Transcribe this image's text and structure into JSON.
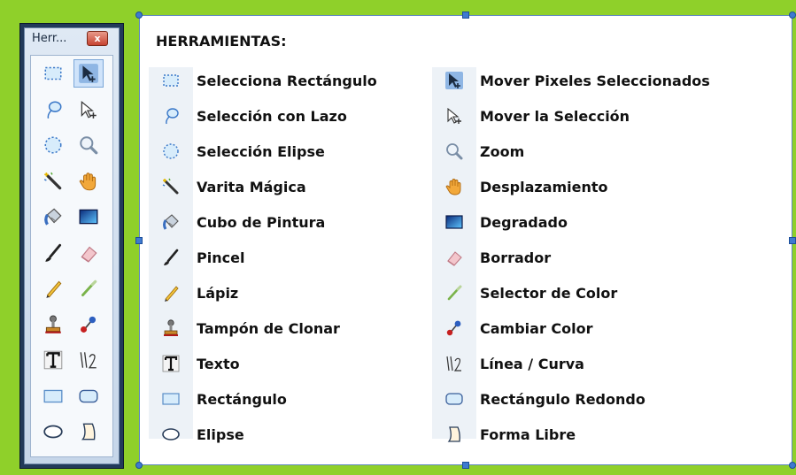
{
  "tools_window": {
    "title": "Herr...",
    "close_label": "x",
    "buttons": [
      {
        "icon": "rect-select-icon"
      },
      {
        "icon": "move-pixels-icon"
      },
      {
        "icon": "lasso-icon"
      },
      {
        "icon": "move-selection-icon"
      },
      {
        "icon": "ellipse-select-icon"
      },
      {
        "icon": "zoom-icon"
      },
      {
        "icon": "magic-wand-icon"
      },
      {
        "icon": "pan-hand-icon"
      },
      {
        "icon": "paint-bucket-icon"
      },
      {
        "icon": "gradient-icon"
      },
      {
        "icon": "paintbrush-icon"
      },
      {
        "icon": "eraser-icon"
      },
      {
        "icon": "pencil-icon"
      },
      {
        "icon": "color-picker-icon"
      },
      {
        "icon": "clone-stamp-icon"
      },
      {
        "icon": "recolor-icon"
      },
      {
        "icon": "text-icon"
      },
      {
        "icon": "line-curve-icon"
      },
      {
        "icon": "rectangle-icon"
      },
      {
        "icon": "rounded-rectangle-icon"
      },
      {
        "icon": "ellipse-icon"
      },
      {
        "icon": "freeform-shape-icon"
      }
    ]
  },
  "panel": {
    "title": "HERRAMIENTAS:",
    "left": [
      {
        "icon": "rect-select-icon",
        "label": "Selecciona Rectángulo"
      },
      {
        "icon": "lasso-icon",
        "label": "Selección con Lazo"
      },
      {
        "icon": "ellipse-select-icon",
        "label": "Selección Elipse"
      },
      {
        "icon": "magic-wand-icon",
        "label": "Varita Mágica"
      },
      {
        "icon": "paint-bucket-icon",
        "label": "Cubo de Pintura"
      },
      {
        "icon": "paintbrush-icon",
        "label": "Pincel"
      },
      {
        "icon": "pencil-icon",
        "label": "Lápiz"
      },
      {
        "icon": "clone-stamp-icon",
        "label": "Tampón de Clonar"
      },
      {
        "icon": "text-icon",
        "label": "Texto"
      },
      {
        "icon": "rectangle-icon",
        "label": "Rectángulo"
      },
      {
        "icon": "ellipse-icon",
        "label": "Elipse"
      }
    ],
    "right": [
      {
        "icon": "move-pixels-icon",
        "label": "Mover Pixeles Seleccionados"
      },
      {
        "icon": "move-selection-icon",
        "label": "Mover la Selección"
      },
      {
        "icon": "zoom-icon",
        "label": "Zoom"
      },
      {
        "icon": "pan-hand-icon",
        "label": "Desplazamiento"
      },
      {
        "icon": "gradient-icon",
        "label": "Degradado"
      },
      {
        "icon": "eraser-icon",
        "label": "Borrador"
      },
      {
        "icon": "color-picker-icon",
        "label": "Selector de Color"
      },
      {
        "icon": "recolor-icon",
        "label": "Cambiar Color"
      },
      {
        "icon": "line-curve-icon",
        "label": "Línea / Curva"
      },
      {
        "icon": "rounded-rectangle-icon",
        "label": "Rectángulo Redondo"
      },
      {
        "icon": "freeform-shape-icon",
        "label": "Forma Libre"
      }
    ]
  },
  "colors": {
    "background_green": "#8fd02a",
    "window_frame": "#223a5a",
    "handle_blue": "#3e7ad0"
  }
}
